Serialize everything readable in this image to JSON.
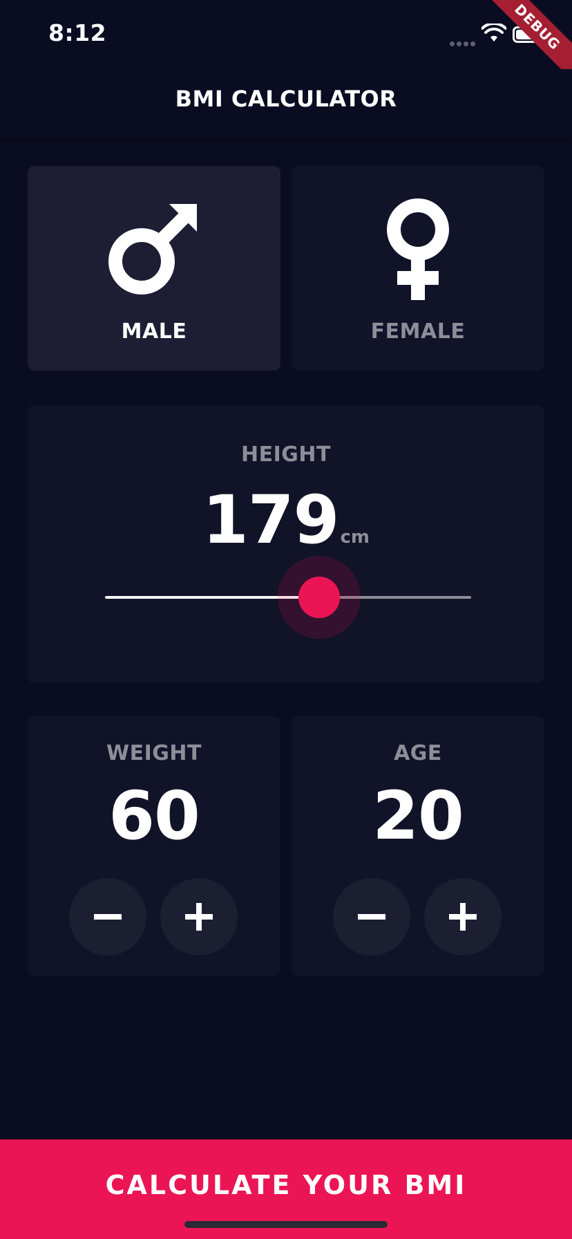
{
  "status_bar": {
    "time": "8:12"
  },
  "debug_banner": "DEBUG",
  "app_bar": {
    "title": "BMI CALCULATOR"
  },
  "gender": {
    "selected": "male",
    "male": {
      "label": "MALE",
      "icon": "male-symbol-icon"
    },
    "female": {
      "label": "FEMALE",
      "icon": "female-symbol-icon"
    }
  },
  "height": {
    "label": "HEIGHT",
    "value": "179",
    "unit": "cm",
    "slider_fraction": 0.585
  },
  "weight": {
    "label": "WEIGHT",
    "value": "60"
  },
  "age": {
    "label": "AGE",
    "value": "20"
  },
  "controls": {
    "minus_icon": "minus-icon",
    "plus_icon": "plus-icon"
  },
  "calculate_button": {
    "label": "CALCULATE YOUR BMI"
  },
  "colors": {
    "background": "#0a0d22",
    "card": "#111328",
    "card_active": "#1d1e33",
    "accent": "#eb1555",
    "muted_text": "#8d8e98",
    "round_button": "#1c1f32"
  }
}
